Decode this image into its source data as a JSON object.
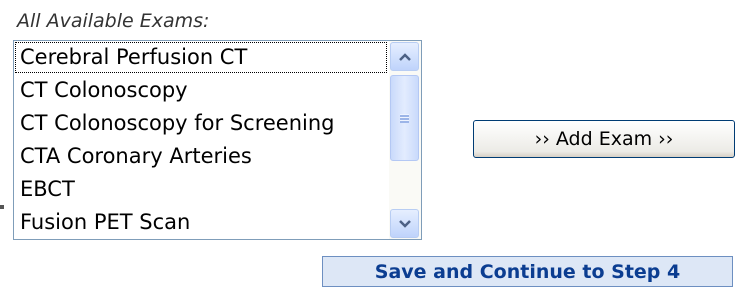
{
  "heading": "All Available Exams:",
  "exam_list": {
    "items": [
      "Cerebral Perfusion CT",
      "CT Colonoscopy",
      "CT Colonoscopy for Screening",
      "CTA Coronary Arteries",
      "EBCT",
      "Fusion PET Scan"
    ],
    "focused_item": "Cerebral Perfusion CT"
  },
  "add_button_label": "›› Add Exam ››",
  "save_button_label": "Save and Continue to Step 4",
  "colors": {
    "list_border": "#7f9db9",
    "scrollbar_accent": "#bfd3fb",
    "save_button_bg": "#dde7f6",
    "save_button_text": "#0b3d91"
  }
}
